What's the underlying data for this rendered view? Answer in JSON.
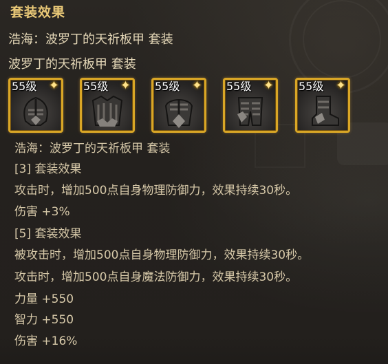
{
  "tooltip": {
    "title": "套装效果",
    "set_full_name": "浩海：波罗丁的天祈板甲  套装",
    "set_name": "波罗丁的天祈板甲  套装",
    "items": [
      {
        "level": "55级",
        "icon": "helmet-icon"
      },
      {
        "level": "55级",
        "icon": "chest-armor-icon"
      },
      {
        "level": "55级",
        "icon": "shoulder-armor-icon"
      },
      {
        "level": "55级",
        "icon": "leg-armor-icon"
      },
      {
        "level": "55级",
        "icon": "boots-icon"
      }
    ],
    "details": {
      "set_name": "浩海：波罗丁的天祈板甲  套装",
      "bonus3_header": "[3] 套装效果",
      "bonus3_effect": "攻击时，增加500点自身物理防御力，效果持续30秒。",
      "bonus3_stat": "伤害 +3%",
      "bonus5_header": "[5] 套装效果",
      "bonus5_effect1": "被攻击时，增加500点自身物理防御力，效果持续30秒。",
      "bonus5_effect2": "攻击时，增加500点自身魔法防御力，效果持续30秒。",
      "bonus5_stat1": "力量 +550",
      "bonus5_stat2": "智力 +550",
      "bonus5_stat3": "伤害 +16%"
    },
    "colors": {
      "title": "#e9c877",
      "text": "#d7c9a9",
      "slot_border": "#d9a626",
      "background": "#24211e"
    }
  }
}
